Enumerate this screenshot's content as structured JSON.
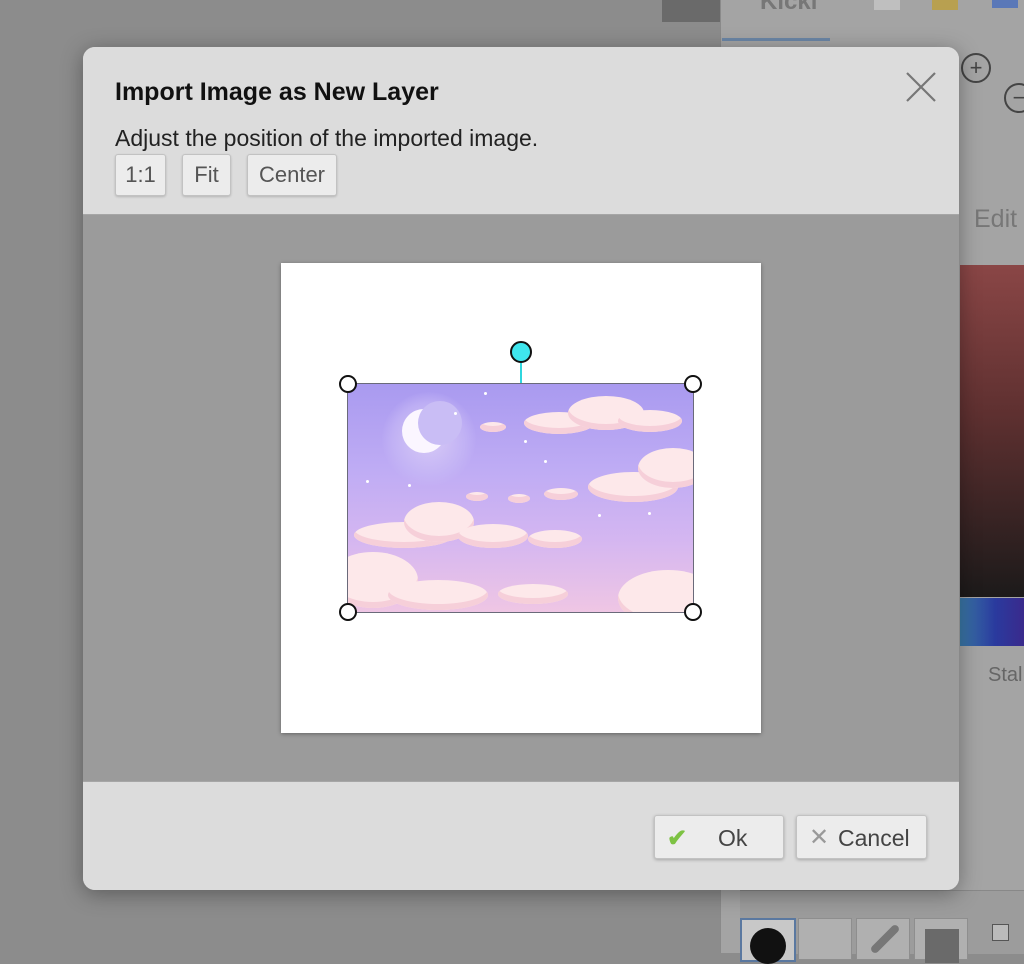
{
  "background": {
    "tab_label": "Kicki",
    "edit_label": "Edit",
    "stab_label": "Stal",
    "zoom_in_icon": "plus-circle-icon",
    "zoom_out_icon": "minus-circle-icon"
  },
  "dialog": {
    "title": "Import Image as New Layer",
    "subtitle": "Adjust the position of the imported image.",
    "close_icon": "close-icon",
    "buttons": {
      "one_to_one": "1:1",
      "fit": "Fit",
      "center": "Center"
    },
    "footer": {
      "ok_label": "Ok",
      "ok_icon": "checkmark-icon",
      "ok_icon_color": "#7dc243",
      "cancel_label": "Cancel",
      "cancel_icon": "x-icon"
    },
    "preview": {
      "canvas_color": "#ffffff",
      "image_description_icon": "pastel-night-sky-clouds-moon",
      "rotate_handle_color": "#3fe6ee"
    }
  }
}
